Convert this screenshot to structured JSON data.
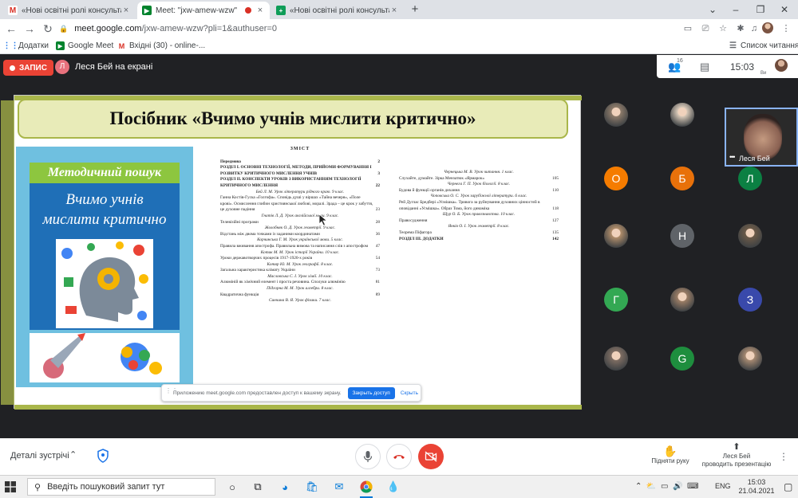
{
  "browser": {
    "tabs": [
      {
        "title": "«Нові освітні ролі консультанта",
        "favicon": "gmail-icon",
        "active": false
      },
      {
        "title": "Meet: \"jxw-amew-wzw\"",
        "favicon": "meet-icon",
        "active": true,
        "recording": true
      },
      {
        "title": "«Нові освітні ролі консультанта",
        "favicon": "sheets-icon",
        "active": false
      }
    ],
    "url_host": "meet.google.com",
    "url_path": "/jxw-amew-wzw?pli=1&authuser=0",
    "bookmarks": [
      {
        "label": "Додатки",
        "icon": "apps-grid-icon"
      },
      {
        "label": "Google Meet",
        "icon": "meet-icon"
      },
      {
        "label": "Вхідні (30) - online-...",
        "icon": "gmail-icon"
      }
    ],
    "reading_list": "Список читання"
  },
  "meet": {
    "recording_label": "ЗАПИС",
    "presenter_initial": "Л",
    "presenter_label": "Леся Бей на екрані",
    "participant_count": "16",
    "time": "15:03",
    "self_short": "Ви",
    "self_name": "Леся Бей",
    "share_message": "Приложению meet.google.com предоставлен доступ к вашему экрану.",
    "share_stop": "Закрыть доступ",
    "share_hide": "Скрыть",
    "details_label": "Деталі зустрічі",
    "raise_hand": "Підняти руку",
    "presenting_line1": "Леся Бей",
    "presenting_line2": "проводить презентацію",
    "participants": [
      {
        "kind": "photo",
        "initial": "",
        "color": "#8d7b6a"
      },
      {
        "kind": "photo",
        "initial": "",
        "color": "#d8c9b8"
      },
      {
        "kind": "letter",
        "initial": "О",
        "color": "#f57c00"
      },
      {
        "kind": "letter",
        "initial": "Б",
        "color": "#e8710a"
      },
      {
        "kind": "letter",
        "initial": "Л",
        "color": "#0b8043"
      },
      {
        "kind": "photo",
        "initial": "",
        "color": "#b08d6a"
      },
      {
        "kind": "letter",
        "initial": "Н",
        "color": "#5f6368"
      },
      {
        "kind": "photo",
        "initial": "",
        "color": "#6b5a48"
      },
      {
        "kind": "letter",
        "initial": "Г",
        "color": "#33a853"
      },
      {
        "kind": "photo",
        "initial": "",
        "color": "#9c7e66"
      },
      {
        "kind": "letter",
        "initial": "З",
        "color": "#3949ab"
      },
      {
        "kind": "photo",
        "initial": "",
        "color": "#7e6d62"
      },
      {
        "kind": "letter",
        "initial": "G",
        "color": "#1e8e3e"
      },
      {
        "kind": "photo",
        "initial": "",
        "color": "#a78a72"
      }
    ]
  },
  "slide": {
    "title": "Посібник «Вчимо учнів мислити критично»",
    "book_series": "Методичний пошук",
    "book_title_line1": "Вчимо учнів",
    "book_title_line2": "мислити критично",
    "toc_heading": "ЗМІСТ",
    "toc_left": [
      {
        "type": "row",
        "text": "Передмова",
        "page": "2",
        "bold": true
      },
      {
        "type": "row",
        "text": "РОЗДІЛ І. ОСНОВНІ ТЕХНОЛОГІЇ, МЕТОДИ, ПРИЙОМИ ФОРМУВАННЯ І РОЗВИТКУ КРИТИЧНОГО МИСЛЕННЯ УЧНІВ",
        "page": "3",
        "bold": true
      },
      {
        "type": "row",
        "text": "РОЗДІЛ ІІ. КОНСПЕКТИ УРОКІВ З ВИКОРИСТАННЯМ ТЕХНОЛОГІЇ КРИТИЧНОГО МИСЛЕННЯ",
        "page": "22",
        "bold": true
      },
      {
        "type": "author",
        "text": "Бей Л. М. Урок літератури рідного краю. 9 клас."
      },
      {
        "type": "row",
        "text": "Ганна Костів-Гуска «Голгофа». Сповідь душі у віршах «Тайна вечеря», «Поле крові». Осмислення глибин християнської любові, моралі. Зрада – це крок у забуття, це духовне падіння",
        "page": "23",
        "bold": false
      },
      {
        "type": "author",
        "text": "Гнатів Л. Д. Урок англійської мови. 9 клас."
      },
      {
        "type": "row",
        "text": "Телевізійні програми",
        "page": "28",
        "bold": false
      },
      {
        "type": "author",
        "text": "Жолобняк О. Д. Урок геометрії. 9 клас."
      },
      {
        "type": "row",
        "text": "Відстань між двома точками із заданими координатами",
        "page": "36",
        "bold": false
      },
      {
        "type": "author",
        "text": "Корчинська Г. М. Урок української мови. 5 клас."
      },
      {
        "type": "row",
        "text": "Правила вживання апострофа. Правильна вимова та написання слів з апострофом",
        "page": "47",
        "bold": false
      },
      {
        "type": "author",
        "text": "Котик М. М. Урок історії України. 10 клас."
      },
      {
        "type": "row",
        "text": "Уроки державотворчих процесів 1917-1920-х років",
        "page": "54",
        "bold": false
      },
      {
        "type": "author",
        "text": "Котяр Ю. М. Урок географії. 8 клас."
      },
      {
        "type": "row",
        "text": "Загальна характеристика клімату України",
        "page": "73",
        "bold": false
      },
      {
        "type": "author",
        "text": "Масловська С. І. Урок хімії. 10 клас."
      },
      {
        "type": "row",
        "text": "Алюміній як хімічний елемент і проста речовина. Сполуки алюмінію",
        "page": "81",
        "bold": false
      },
      {
        "type": "author",
        "text": "Підгорна М. М. Урок алгебри. 8 клас."
      },
      {
        "type": "row",
        "text": "Квадратична функція",
        "page": "89",
        "bold": false
      },
      {
        "type": "author",
        "text": "Синчина В. Я. Урок фізики. 7 клас."
      }
    ],
    "toc_right": [
      {
        "type": "author",
        "text": "Чернецька М. В. Урок читання. 1 клас."
      },
      {
        "type": "row",
        "text": "Слухайте, думайте. Зірка Мензатюк «Ярмарок»",
        "page": "105",
        "bold": false
      },
      {
        "type": "author",
        "text": "Чернега Г. П. Урок біології. 8 клас."
      },
      {
        "type": "row",
        "text": "Будова й функції органів дихання",
        "page": "110",
        "bold": false
      },
      {
        "type": "author",
        "text": "Чоповська О. С. Урок зарубіжної літератури. 6 клас."
      },
      {
        "type": "row",
        "text": "Рей Дуглас Бредбері «Усмішка». Тривога за руйнування духовних цінностей в оповіданні «Усмішка». Образ Тома, його динаміка",
        "page": "118",
        "bold": false
      },
      {
        "type": "author",
        "text": "Щур О. Б. Урок правознавства. 10 клас."
      },
      {
        "type": "row",
        "text": "Правосудження",
        "page": "127",
        "bold": false
      },
      {
        "type": "author",
        "text": "Янків О. І. Урок геометрії. 8 клас."
      },
      {
        "type": "row",
        "text": "Теорема Піфагора",
        "page": "135",
        "bold": false
      },
      {
        "type": "row",
        "text": "РОЗДІЛ ІІІ. ДОДАТКИ",
        "page": "142",
        "bold": true
      }
    ]
  },
  "taskbar": {
    "search_placeholder": "Введіть пошуковий запит тут",
    "lang": "ENG",
    "time": "15:03",
    "date": "21.04.2021",
    "apps": [
      "task-view-icon",
      "edge-icon",
      "store-icon",
      "mail-icon",
      "chrome-icon",
      "paint3d-icon"
    ]
  },
  "colors": {
    "slide_accent": "#a9b64a",
    "title_fill": "#e8ebb8",
    "record_red": "#ea4335",
    "meet_dark": "#202124",
    "primary_blue": "#1a73e8"
  }
}
